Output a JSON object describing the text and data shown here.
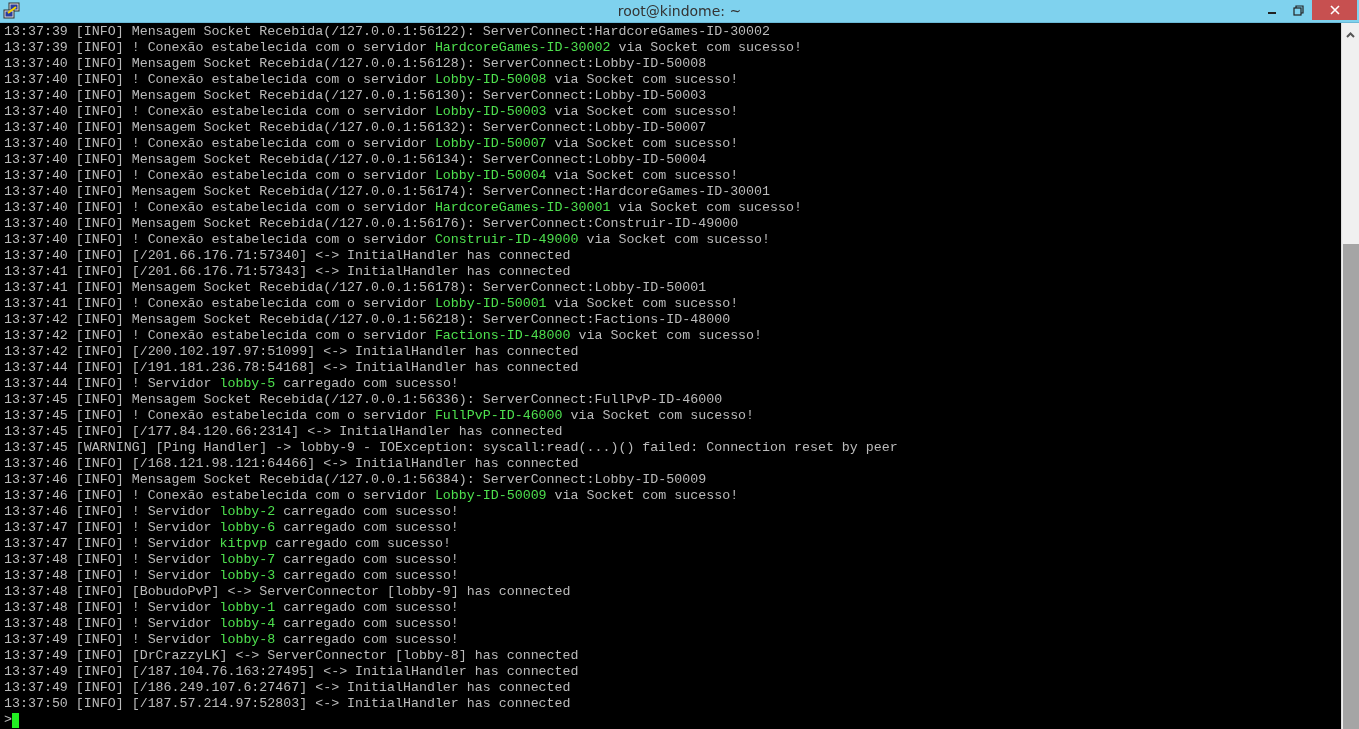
{
  "window": {
    "title": "root@kindome: ~"
  },
  "lines": [
    [
      {
        "text": "13:37:39 [INFO] Mensagem Socket Recebida(/127.0.0.1:56122): ServerConnect:HardcoreGames-ID-30002",
        "highlight": false
      }
    ],
    [
      {
        "text": "13:37:39 [INFO] ! Conexão estabelecida com o servidor ",
        "highlight": false
      },
      {
        "text": "HardcoreGames-ID-30002",
        "highlight": true
      },
      {
        "text": " via Socket com sucesso!",
        "highlight": false
      }
    ],
    [
      {
        "text": "13:37:40 [INFO] Mensagem Socket Recebida(/127.0.0.1:56128): ServerConnect:Lobby-ID-50008",
        "highlight": false
      }
    ],
    [
      {
        "text": "13:37:40 [INFO] ! Conexão estabelecida com o servidor ",
        "highlight": false
      },
      {
        "text": "Lobby-ID-50008",
        "highlight": true
      },
      {
        "text": " via Socket com sucesso!",
        "highlight": false
      }
    ],
    [
      {
        "text": "13:37:40 [INFO] Mensagem Socket Recebida(/127.0.0.1:56130): ServerConnect:Lobby-ID-50003",
        "highlight": false
      }
    ],
    [
      {
        "text": "13:37:40 [INFO] ! Conexão estabelecida com o servidor ",
        "highlight": false
      },
      {
        "text": "Lobby-ID-50003",
        "highlight": true
      },
      {
        "text": " via Socket com sucesso!",
        "highlight": false
      }
    ],
    [
      {
        "text": "13:37:40 [INFO] Mensagem Socket Recebida(/127.0.0.1:56132): ServerConnect:Lobby-ID-50007",
        "highlight": false
      }
    ],
    [
      {
        "text": "13:37:40 [INFO] ! Conexão estabelecida com o servidor ",
        "highlight": false
      },
      {
        "text": "Lobby-ID-50007",
        "highlight": true
      },
      {
        "text": " via Socket com sucesso!",
        "highlight": false
      }
    ],
    [
      {
        "text": "13:37:40 [INFO] Mensagem Socket Recebida(/127.0.0.1:56134): ServerConnect:Lobby-ID-50004",
        "highlight": false
      }
    ],
    [
      {
        "text": "13:37:40 [INFO] ! Conexão estabelecida com o servidor ",
        "highlight": false
      },
      {
        "text": "Lobby-ID-50004",
        "highlight": true
      },
      {
        "text": " via Socket com sucesso!",
        "highlight": false
      }
    ],
    [
      {
        "text": "13:37:40 [INFO] Mensagem Socket Recebida(/127.0.0.1:56174): ServerConnect:HardcoreGames-ID-30001",
        "highlight": false
      }
    ],
    [
      {
        "text": "13:37:40 [INFO] ! Conexão estabelecida com o servidor ",
        "highlight": false
      },
      {
        "text": "HardcoreGames-ID-30001",
        "highlight": true
      },
      {
        "text": " via Socket com sucesso!",
        "highlight": false
      }
    ],
    [
      {
        "text": "13:37:40 [INFO] Mensagem Socket Recebida(/127.0.0.1:56176): ServerConnect:Construir-ID-49000",
        "highlight": false
      }
    ],
    [
      {
        "text": "13:37:40 [INFO] ! Conexão estabelecida com o servidor ",
        "highlight": false
      },
      {
        "text": "Construir-ID-49000",
        "highlight": true
      },
      {
        "text": " via Socket com sucesso!",
        "highlight": false
      }
    ],
    [
      {
        "text": "13:37:40 [INFO] [/201.66.176.71:57340] <-> InitialHandler has connected",
        "highlight": false
      }
    ],
    [
      {
        "text": "13:37:41 [INFO] [/201.66.176.71:57343] <-> InitialHandler has connected",
        "highlight": false
      }
    ],
    [
      {
        "text": "13:37:41 [INFO] Mensagem Socket Recebida(/127.0.0.1:56178): ServerConnect:Lobby-ID-50001",
        "highlight": false
      }
    ],
    [
      {
        "text": "13:37:41 [INFO] ! Conexão estabelecida com o servidor ",
        "highlight": false
      },
      {
        "text": "Lobby-ID-50001",
        "highlight": true
      },
      {
        "text": " via Socket com sucesso!",
        "highlight": false
      }
    ],
    [
      {
        "text": "13:37:42 [INFO] Mensagem Socket Recebida(/127.0.0.1:56218): ServerConnect:Factions-ID-48000",
        "highlight": false
      }
    ],
    [
      {
        "text": "13:37:42 [INFO] ! Conexão estabelecida com o servidor ",
        "highlight": false
      },
      {
        "text": "Factions-ID-48000",
        "highlight": true
      },
      {
        "text": " via Socket com sucesso!",
        "highlight": false
      }
    ],
    [
      {
        "text": "13:37:42 [INFO] [/200.102.197.97:51099] <-> InitialHandler has connected",
        "highlight": false
      }
    ],
    [
      {
        "text": "13:37:44 [INFO] [/191.181.236.78:54168] <-> InitialHandler has connected",
        "highlight": false
      }
    ],
    [
      {
        "text": "13:37:44 [INFO] ! Servidor ",
        "highlight": false
      },
      {
        "text": "lobby-5",
        "highlight": true
      },
      {
        "text": " carregado com sucesso!",
        "highlight": false
      }
    ],
    [
      {
        "text": "13:37:45 [INFO] Mensagem Socket Recebida(/127.0.0.1:56336): ServerConnect:FullPvP-ID-46000",
        "highlight": false
      }
    ],
    [
      {
        "text": "13:37:45 [INFO] ! Conexão estabelecida com o servidor ",
        "highlight": false
      },
      {
        "text": "FullPvP-ID-46000",
        "highlight": true
      },
      {
        "text": " via Socket com sucesso!",
        "highlight": false
      }
    ],
    [
      {
        "text": "13:37:45 [INFO] [/177.84.120.66:2314] <-> InitialHandler has connected",
        "highlight": false
      }
    ],
    [
      {
        "text": "13:37:45 [WARNING] [Ping Handler] -> lobby-9 - IOException: syscall:read(...)() failed: Connection reset by peer",
        "highlight": false
      }
    ],
    [
      {
        "text": "13:37:46 [INFO] [/168.121.98.121:64466] <-> InitialHandler has connected",
        "highlight": false
      }
    ],
    [
      {
        "text": "13:37:46 [INFO] Mensagem Socket Recebida(/127.0.0.1:56384): ServerConnect:Lobby-ID-50009",
        "highlight": false
      }
    ],
    [
      {
        "text": "13:37:46 [INFO] ! Conexão estabelecida com o servidor ",
        "highlight": false
      },
      {
        "text": "Lobby-ID-50009",
        "highlight": true
      },
      {
        "text": " via Socket com sucesso!",
        "highlight": false
      }
    ],
    [
      {
        "text": "13:37:46 [INFO] ! Servidor ",
        "highlight": false
      },
      {
        "text": "lobby-2",
        "highlight": true
      },
      {
        "text": " carregado com sucesso!",
        "highlight": false
      }
    ],
    [
      {
        "text": "13:37:47 [INFO] ! Servidor ",
        "highlight": false
      },
      {
        "text": "lobby-6",
        "highlight": true
      },
      {
        "text": " carregado com sucesso!",
        "highlight": false
      }
    ],
    [
      {
        "text": "13:37:47 [INFO] ! Servidor ",
        "highlight": false
      },
      {
        "text": "kitpvp",
        "highlight": true
      },
      {
        "text": " carregado com sucesso!",
        "highlight": false
      }
    ],
    [
      {
        "text": "13:37:48 [INFO] ! Servidor ",
        "highlight": false
      },
      {
        "text": "lobby-7",
        "highlight": true
      },
      {
        "text": " carregado com sucesso!",
        "highlight": false
      }
    ],
    [
      {
        "text": "13:37:48 [INFO] ! Servidor ",
        "highlight": false
      },
      {
        "text": "lobby-3",
        "highlight": true
      },
      {
        "text": " carregado com sucesso!",
        "highlight": false
      }
    ],
    [
      {
        "text": "13:37:48 [INFO] [BobudoPvP] <-> ServerConnector [lobby-9] has connected",
        "highlight": false
      }
    ],
    [
      {
        "text": "13:37:48 [INFO] ! Servidor ",
        "highlight": false
      },
      {
        "text": "lobby-1",
        "highlight": true
      },
      {
        "text": " carregado com sucesso!",
        "highlight": false
      }
    ],
    [
      {
        "text": "13:37:48 [INFO] ! Servidor ",
        "highlight": false
      },
      {
        "text": "lobby-4",
        "highlight": true
      },
      {
        "text": " carregado com sucesso!",
        "highlight": false
      }
    ],
    [
      {
        "text": "13:37:49 [INFO] ! Servidor ",
        "highlight": false
      },
      {
        "text": "lobby-8",
        "highlight": true
      },
      {
        "text": " carregado com sucesso!",
        "highlight": false
      }
    ],
    [
      {
        "text": "13:37:49 [INFO] [DrCrazzyLK] <-> ServerConnector [lobby-8] has connected",
        "highlight": false
      }
    ],
    [
      {
        "text": "13:37:49 [INFO] [/187.104.76.163:27495] <-> InitialHandler has connected",
        "highlight": false
      }
    ],
    [
      {
        "text": "13:37:49 [INFO] [/186.249.107.6:27467] <-> InitialHandler has connected",
        "highlight": false
      }
    ],
    [
      {
        "text": "13:37:50 [INFO] [/187.57.214.97:52803] <-> InitialHandler has connected",
        "highlight": false
      }
    ]
  ],
  "prompt": ">"
}
